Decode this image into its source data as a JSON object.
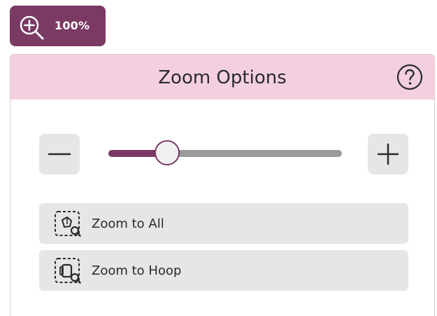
{
  "zoom_toggle": {
    "value_label": "100%",
    "icon": "zoom-in-icon",
    "background": "#7b3a64"
  },
  "panel": {
    "title": "Zoom Options",
    "help_icon": "help-icon",
    "header_color": "#f3cfe0"
  },
  "zoom_slider": {
    "level_fraction": 0.25,
    "minus_icon": "minus-icon",
    "plus_icon": "plus-icon",
    "accent_color": "#7b3a64",
    "track_color": "#9a9a9a"
  },
  "actions": {
    "zoom_all_label": "Zoom to All",
    "zoom_all_icon": "zoom-to-all-icon",
    "zoom_hoop_label": "Zoom to Hoop",
    "zoom_hoop_icon": "zoom-to-hoop-icon"
  }
}
